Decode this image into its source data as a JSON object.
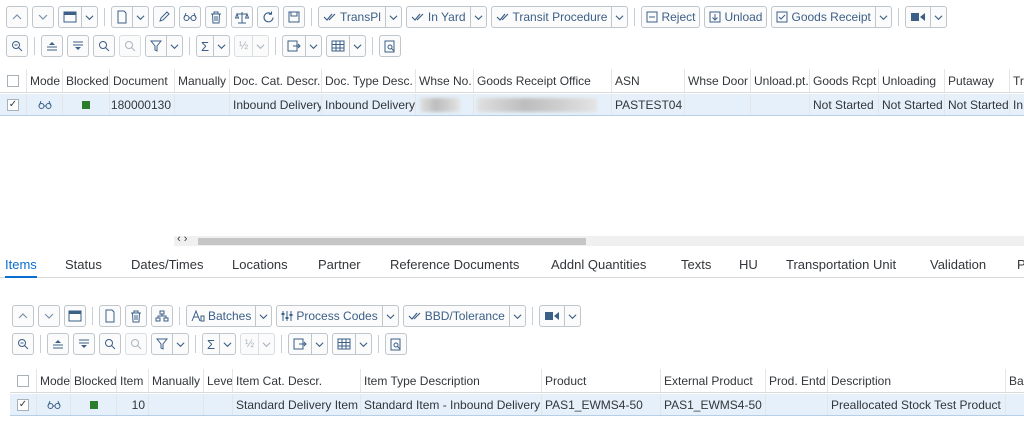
{
  "toolbar1": {
    "transpl": "TransPl",
    "in_yard": "In Yard",
    "transit_procedure": "Transit Procedure",
    "reject": "Reject",
    "unload": "Unload",
    "goods_receipt": "Goods Receipt"
  },
  "header_table": {
    "columns": [
      "Mode",
      "Blocked",
      "Document",
      "Manually",
      "Doc. Cat. Descr.",
      "Doc. Type Desc.",
      "Whse No.",
      "Goods Receipt Office",
      "ASN",
      "Whse Door",
      "Unload.pt.",
      "Goods Rcpt",
      "Unloading",
      "Putaway",
      "Tr"
    ],
    "row": {
      "document": "180000130",
      "doc_cat_descr": "Inbound Delivery",
      "doc_type_desc": "Inbound Delivery",
      "asn": "PASTEST04",
      "goods_rcpt": "Not Started",
      "unloading": "Not Started",
      "putaway": "Not Started",
      "tr": "In"
    }
  },
  "tabs": [
    "Items",
    "Status",
    "Dates/Times",
    "Locations",
    "Partner",
    "Reference Documents",
    "Addnl Quantities",
    "Texts",
    "HU",
    "Transportation Unit",
    "Validation",
    "P"
  ],
  "toolbar2": {
    "batches": "Batches",
    "process_codes": "Process Codes",
    "bbd_tolerance": "BBD/Tolerance"
  },
  "items_table": {
    "columns": [
      "Mode",
      "Blocked",
      "Item",
      "Manually",
      "Level",
      "Item Cat. Descr.",
      "Item Type Description",
      "Product",
      "External Product",
      "Prod. Entd",
      "Description",
      "Ba"
    ],
    "row": {
      "item": "10",
      "item_cat_descr": "Standard Delivery Item",
      "item_type_description": "Standard Item - Inbound Delivery",
      "product": "PAS1_EWMS4-50",
      "external_product": "PAS1_EWMS4-50",
      "description": "Preallocated Stock Test Product"
    }
  },
  "scroll_arrows": "‹ ›"
}
